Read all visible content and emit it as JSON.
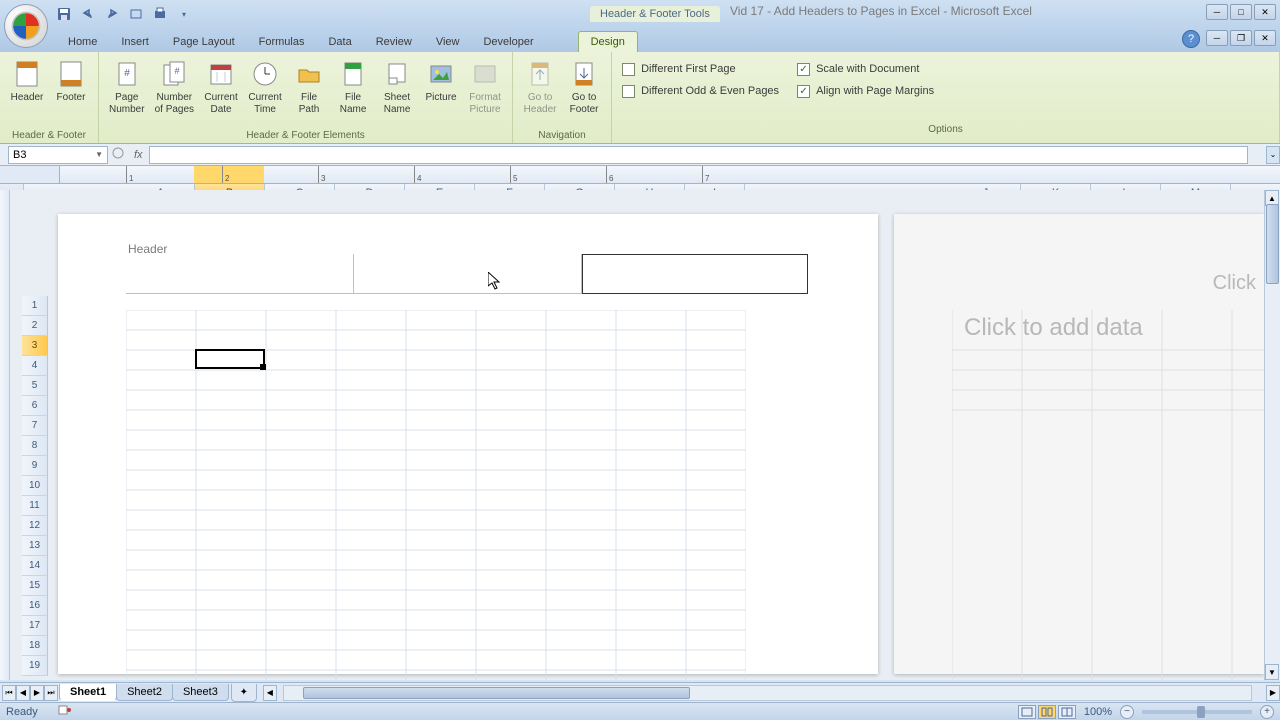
{
  "app": {
    "contextual_tab_label": "Header & Footer Tools",
    "title": "Vid 17 - Add Headers to Pages in Excel - Microsoft Excel"
  },
  "tabs": {
    "home": "Home",
    "insert": "Insert",
    "page_layout": "Page Layout",
    "formulas": "Formulas",
    "data": "Data",
    "review": "Review",
    "view": "View",
    "developer": "Developer",
    "design": "Design"
  },
  "ribbon": {
    "hf": {
      "header": "Header",
      "footer": "Footer",
      "group_label": "Header & Footer"
    },
    "elements": {
      "page_number": "Page\nNumber",
      "number_of_pages": "Number\nof Pages",
      "current_date": "Current\nDate",
      "current_time": "Current\nTime",
      "file_path": "File\nPath",
      "file_name": "File\nName",
      "sheet_name": "Sheet\nName",
      "picture": "Picture",
      "format_picture": "Format\nPicture",
      "group_label": "Header & Footer Elements"
    },
    "nav": {
      "goto_header": "Go to\nHeader",
      "goto_footer": "Go to\nFooter",
      "group_label": "Navigation"
    },
    "options": {
      "diff_first": "Different First Page",
      "diff_odd_even": "Different Odd & Even Pages",
      "scale": "Scale with Document",
      "align_margins": "Align with Page Margins",
      "group_label": "Options",
      "diff_first_checked": false,
      "diff_odd_even_checked": false,
      "scale_checked": true,
      "align_margins_checked": true
    }
  },
  "formula_bar": {
    "name_box": "B3",
    "fx": "fx",
    "value": ""
  },
  "columns": [
    "A",
    "B",
    "C",
    "D",
    "E",
    "F",
    "G",
    "H",
    "I",
    "J",
    "K",
    "L",
    "M"
  ],
  "rows": [
    1,
    2,
    3,
    4,
    5,
    6,
    7,
    8,
    9,
    10,
    11,
    12,
    13,
    14,
    15,
    16,
    17,
    18,
    19
  ],
  "selected": {
    "col": "B",
    "row": 3
  },
  "page": {
    "header_label": "Header",
    "click_add": "Click to add data",
    "click_add2": "Click"
  },
  "sheets": {
    "s1": "Sheet1",
    "s2": "Sheet2",
    "s3": "Sheet3"
  },
  "status": {
    "ready": "Ready",
    "zoom": "100%"
  },
  "ruler_marks": [
    1,
    2,
    3,
    4,
    5,
    6,
    7
  ]
}
